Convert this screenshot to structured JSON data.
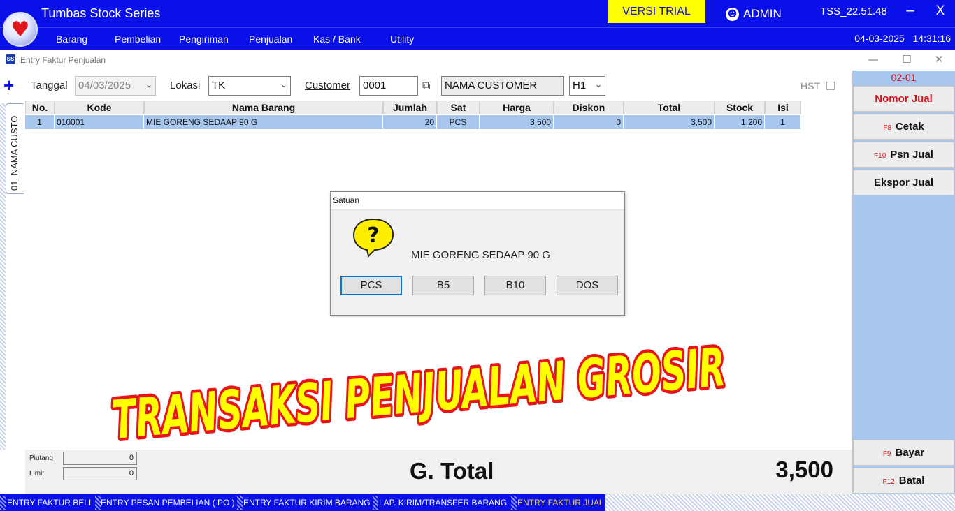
{
  "app": {
    "title": "Tumbas Stock Series",
    "trial_badge": "VERSI TRIAL",
    "user": "ADMIN",
    "version": "TSS_22.51.48",
    "minimize": "–",
    "close": "X",
    "colors": {
      "brand_blue": "#0a10e8",
      "trial_yellow": "#ffff00",
      "selection_blue": "#a7c7ef",
      "accent_red": "#d6101a"
    }
  },
  "menu": {
    "items": [
      "Barang",
      "Pembelian",
      "Pengiriman",
      "Penjualan",
      "Kas / Bank",
      "Utility"
    ],
    "date": "04-03-2025",
    "time": "14:31:16"
  },
  "window": {
    "icon_text": "SS",
    "title": "Entry Faktur Penjualan",
    "controls": [
      "—",
      "☐",
      "✕"
    ]
  },
  "form": {
    "tanggal_label": "Tanggal",
    "tanggal_value": "04/03/2025",
    "lokasi_label": "Lokasi",
    "lokasi_value": "TK",
    "customer_label": "Customer",
    "customer_code": "0001",
    "customer_name": "NAMA CUSTOMER",
    "price_level": "H1",
    "hst_label": "HST",
    "side_tab": "01. NAMA CUSTO"
  },
  "grid": {
    "columns": [
      "No.",
      "Kode",
      "Nama Barang",
      "Jumlah",
      "Sat",
      "Harga",
      "Diskon",
      "Total",
      "Stock",
      "Isi"
    ],
    "rows": [
      [
        "1",
        "010001",
        "MIE GORENG SEDAAP 90 G",
        "20",
        "PCS",
        "3,500",
        "0",
        "3,500",
        "1,200",
        "1"
      ]
    ]
  },
  "summary": {
    "piutang_label": "Piutang",
    "piutang_value": "0",
    "limit_label": "Limit",
    "limit_value": "0",
    "gtotal_label": "G. Total",
    "gtotal_value": "3,500"
  },
  "right_panel": {
    "code": "02-01",
    "buttons": [
      {
        "key": "",
        "label": "Nomor Jual"
      },
      {
        "key": "F8",
        "label": "Cetak"
      },
      {
        "key": "F10",
        "label": "Psn Jual"
      },
      {
        "key": "",
        "label": "Ekspor Jual"
      },
      {
        "key": "F9",
        "label": "Bayar"
      },
      {
        "key": "F12",
        "label": "Batal"
      }
    ]
  },
  "dialog": {
    "title": "Satuan",
    "message": "MIE GORENG SEDAAP 90 G",
    "options": [
      "PCS",
      "B5",
      "B10",
      "DOS"
    ],
    "icon": "question-balloon-icon"
  },
  "banner": {
    "text": "TRANSAKSI PENJUALAN GROSIR"
  },
  "taskbar": {
    "items": [
      "ENTRY FAKTUR BELI",
      "ENTRY PESAN PEMBELIAN ( PO )",
      "ENTRY FAKTUR KIRIM BARANG",
      "LAP. KIRIM/TRANSFER BARANG",
      "ENTRY FAKTUR JUAL"
    ],
    "active_index": 4
  }
}
